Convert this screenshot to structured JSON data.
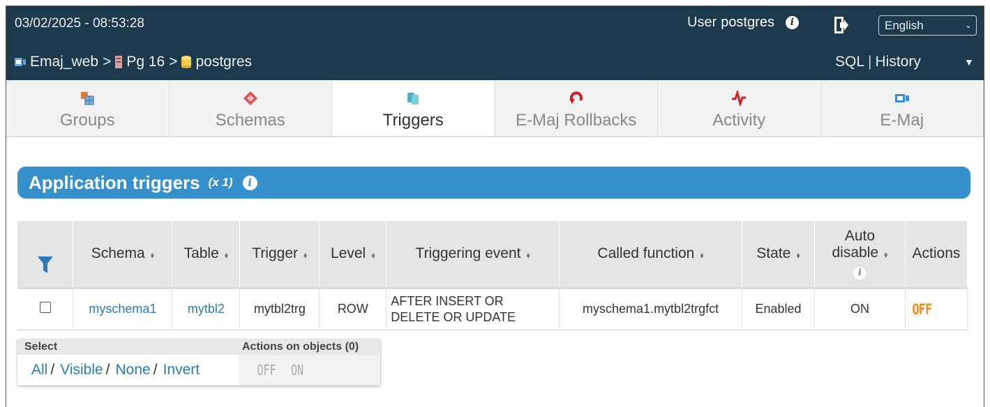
{
  "header": {
    "datetime": "03/02/2025 - 08:53:28",
    "user_label": "User",
    "user_name": "postgres",
    "language": "English",
    "breadcrumb": [
      "Emaj_web",
      "Pg 16",
      "postgres"
    ],
    "sql_label": "SQL",
    "history_label": "History"
  },
  "tabs": [
    {
      "label": "Groups",
      "icon": "groups-icon",
      "active": false
    },
    {
      "label": "Schemas",
      "icon": "schemas-icon",
      "active": false
    },
    {
      "label": "Triggers",
      "icon": "triggers-icon",
      "active": true
    },
    {
      "label": "E-Maj Rollbacks",
      "icon": "rollback-icon",
      "active": false
    },
    {
      "label": "Activity",
      "icon": "activity-icon",
      "active": false
    },
    {
      "label": "E-Maj",
      "icon": "emaj-icon",
      "active": false
    }
  ],
  "section": {
    "title": "Application triggers",
    "count": "(x 1)"
  },
  "table": {
    "headers": {
      "schema": "Schema",
      "table": "Table",
      "trigger": "Trigger",
      "level": "Level",
      "event": "Triggering event",
      "function": "Called function",
      "state": "State",
      "auto_disable_1": "Auto",
      "auto_disable_2": "disable",
      "actions": "Actions"
    },
    "rows": [
      {
        "schema": "myschema1",
        "table": "mytbl2",
        "trigger": "mytbl2trg",
        "level": "ROW",
        "event_line1": "AFTER INSERT OR",
        "event_line2": "DELETE OR UPDATE",
        "function": "myschema1.mytbl2trgfct",
        "state": "Enabled",
        "auto_disable": "ON",
        "action": "OFF"
      }
    ]
  },
  "selection": {
    "select_label": "Select",
    "actions_label": "Actions on objects (0)",
    "all": "All",
    "visible": "Visible",
    "none": "None",
    "invert": "Invert",
    "slash": "/",
    "off": "OFF",
    "on": "ON"
  },
  "colors": {
    "topbar": "#1d3a4c",
    "accent": "#3690cc",
    "link": "#2a7ab8",
    "off_badge": "#f08a22"
  }
}
